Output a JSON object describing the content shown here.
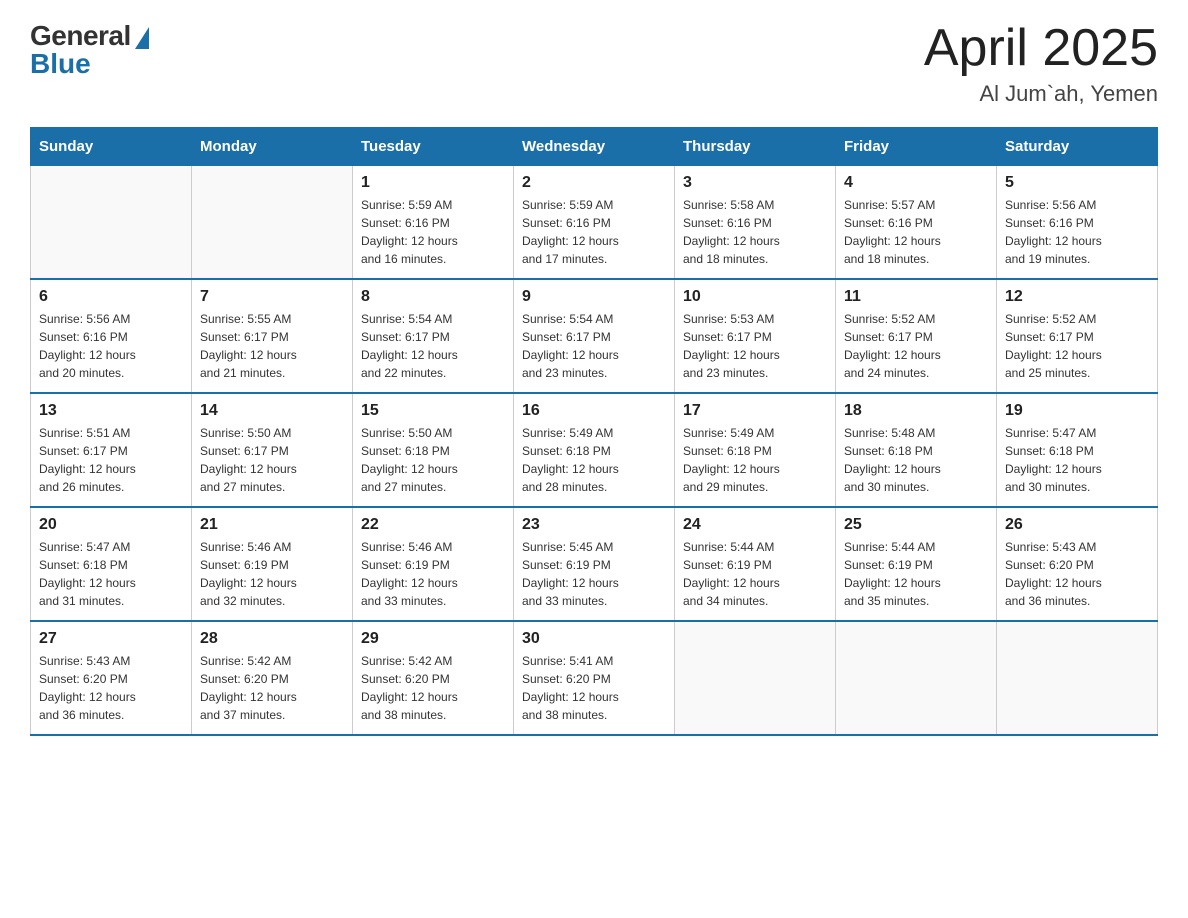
{
  "header": {
    "logo_general": "General",
    "logo_blue": "Blue",
    "month_title": "April 2025",
    "location": "Al Jum`ah, Yemen"
  },
  "weekdays": [
    "Sunday",
    "Monday",
    "Tuesday",
    "Wednesday",
    "Thursday",
    "Friday",
    "Saturday"
  ],
  "weeks": [
    [
      null,
      null,
      {
        "day": "1",
        "sunrise": "5:59 AM",
        "sunset": "6:16 PM",
        "daylight": "12 hours and 16 minutes."
      },
      {
        "day": "2",
        "sunrise": "5:59 AM",
        "sunset": "6:16 PM",
        "daylight": "12 hours and 17 minutes."
      },
      {
        "day": "3",
        "sunrise": "5:58 AM",
        "sunset": "6:16 PM",
        "daylight": "12 hours and 18 minutes."
      },
      {
        "day": "4",
        "sunrise": "5:57 AM",
        "sunset": "6:16 PM",
        "daylight": "12 hours and 18 minutes."
      },
      {
        "day": "5",
        "sunrise": "5:56 AM",
        "sunset": "6:16 PM",
        "daylight": "12 hours and 19 minutes."
      }
    ],
    [
      {
        "day": "6",
        "sunrise": "5:56 AM",
        "sunset": "6:16 PM",
        "daylight": "12 hours and 20 minutes."
      },
      {
        "day": "7",
        "sunrise": "5:55 AM",
        "sunset": "6:17 PM",
        "daylight": "12 hours and 21 minutes."
      },
      {
        "day": "8",
        "sunrise": "5:54 AM",
        "sunset": "6:17 PM",
        "daylight": "12 hours and 22 minutes."
      },
      {
        "day": "9",
        "sunrise": "5:54 AM",
        "sunset": "6:17 PM",
        "daylight": "12 hours and 23 minutes."
      },
      {
        "day": "10",
        "sunrise": "5:53 AM",
        "sunset": "6:17 PM",
        "daylight": "12 hours and 23 minutes."
      },
      {
        "day": "11",
        "sunrise": "5:52 AM",
        "sunset": "6:17 PM",
        "daylight": "12 hours and 24 minutes."
      },
      {
        "day": "12",
        "sunrise": "5:52 AM",
        "sunset": "6:17 PM",
        "daylight": "12 hours and 25 minutes."
      }
    ],
    [
      {
        "day": "13",
        "sunrise": "5:51 AM",
        "sunset": "6:17 PM",
        "daylight": "12 hours and 26 minutes."
      },
      {
        "day": "14",
        "sunrise": "5:50 AM",
        "sunset": "6:17 PM",
        "daylight": "12 hours and 27 minutes."
      },
      {
        "day": "15",
        "sunrise": "5:50 AM",
        "sunset": "6:18 PM",
        "daylight": "12 hours and 27 minutes."
      },
      {
        "day": "16",
        "sunrise": "5:49 AM",
        "sunset": "6:18 PM",
        "daylight": "12 hours and 28 minutes."
      },
      {
        "day": "17",
        "sunrise": "5:49 AM",
        "sunset": "6:18 PM",
        "daylight": "12 hours and 29 minutes."
      },
      {
        "day": "18",
        "sunrise": "5:48 AM",
        "sunset": "6:18 PM",
        "daylight": "12 hours and 30 minutes."
      },
      {
        "day": "19",
        "sunrise": "5:47 AM",
        "sunset": "6:18 PM",
        "daylight": "12 hours and 30 minutes."
      }
    ],
    [
      {
        "day": "20",
        "sunrise": "5:47 AM",
        "sunset": "6:18 PM",
        "daylight": "12 hours and 31 minutes."
      },
      {
        "day": "21",
        "sunrise": "5:46 AM",
        "sunset": "6:19 PM",
        "daylight": "12 hours and 32 minutes."
      },
      {
        "day": "22",
        "sunrise": "5:46 AM",
        "sunset": "6:19 PM",
        "daylight": "12 hours and 33 minutes."
      },
      {
        "day": "23",
        "sunrise": "5:45 AM",
        "sunset": "6:19 PM",
        "daylight": "12 hours and 33 minutes."
      },
      {
        "day": "24",
        "sunrise": "5:44 AM",
        "sunset": "6:19 PM",
        "daylight": "12 hours and 34 minutes."
      },
      {
        "day": "25",
        "sunrise": "5:44 AM",
        "sunset": "6:19 PM",
        "daylight": "12 hours and 35 minutes."
      },
      {
        "day": "26",
        "sunrise": "5:43 AM",
        "sunset": "6:20 PM",
        "daylight": "12 hours and 36 minutes."
      }
    ],
    [
      {
        "day": "27",
        "sunrise": "5:43 AM",
        "sunset": "6:20 PM",
        "daylight": "12 hours and 36 minutes."
      },
      {
        "day": "28",
        "sunrise": "5:42 AM",
        "sunset": "6:20 PM",
        "daylight": "12 hours and 37 minutes."
      },
      {
        "day": "29",
        "sunrise": "5:42 AM",
        "sunset": "6:20 PM",
        "daylight": "12 hours and 38 minutes."
      },
      {
        "day": "30",
        "sunrise": "5:41 AM",
        "sunset": "6:20 PM",
        "daylight": "12 hours and 38 minutes."
      },
      null,
      null,
      null
    ]
  ],
  "labels": {
    "sunrise_prefix": "Sunrise: ",
    "sunset_prefix": "Sunset: ",
    "daylight_prefix": "Daylight: "
  }
}
